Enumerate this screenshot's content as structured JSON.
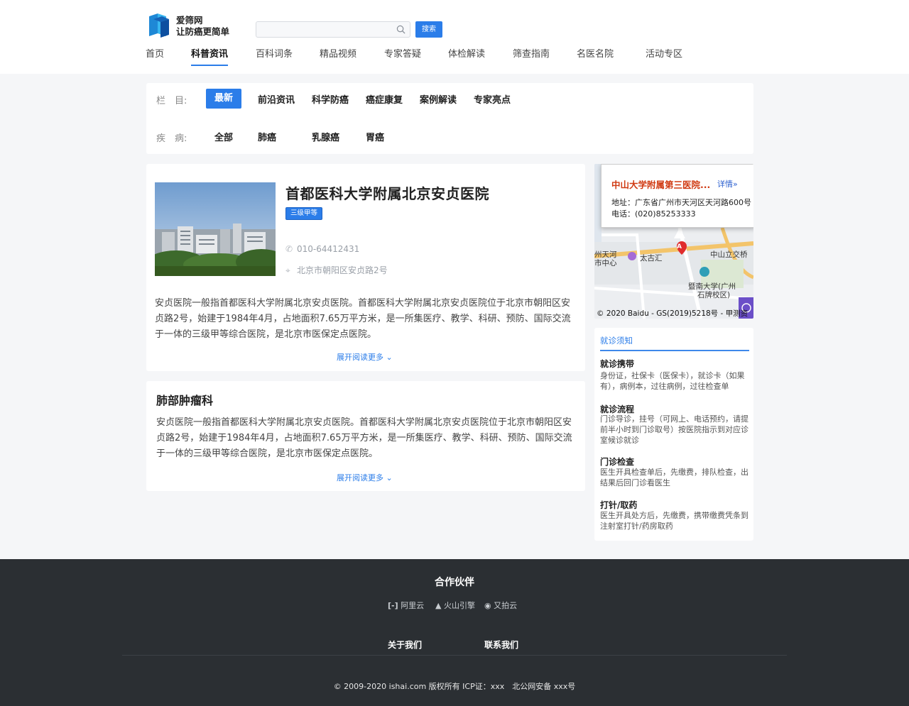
{
  "brand": {
    "name": "爱筛网",
    "slogan": "让防癌更简单"
  },
  "search": {
    "placeholder": "",
    "button": "搜索"
  },
  "nav": [
    "首页",
    "科普资讯",
    "百科词条",
    "精品视频",
    "专家答疑",
    "体检解读",
    "筛查指南",
    "名医名院",
    "活动专区"
  ],
  "nav_active": "科普资讯",
  "filters": {
    "column_label": "栏　目:",
    "columns": [
      "最新",
      "前沿资讯",
      "科学防癌",
      "癌症康复",
      "案例解读",
      "专家亮点"
    ],
    "column_active": "最新",
    "disease_label": "疾　病:",
    "diseases": [
      "全部",
      "肺癌",
      "乳腺癌",
      "胃癌"
    ]
  },
  "hospital": {
    "name": "首都医科大学附属北京安贞医院",
    "level": "三级甲等",
    "phone": "010-64412431",
    "address": "北京市朝阳区安贞路2号",
    "description": "安贞医院一般指首都医科大学附属北京安贞医院。首都医科大学附属北京安贞医院位于北京市朝阳区安贞路2号，始建于1984年4月，占地面积7.65万平方米，是一所集医疗、教学、科研、预防、国际交流于一体的三级甲等综合医院，是北京市医保定点医院。",
    "more": "展开阅读更多"
  },
  "department": {
    "title": "肺部肿瘤科",
    "description": "安贞医院一般指首都医科大学附属北京安贞医院。首都医科大学附属北京安贞医院位于北京市朝阳区安贞路2号，始建于1984年4月，占地面积7.65万平方米，是一所集医疗、教学、科研、预防、国际交流于一体的三级甲等综合医院，是北京市医保定点医院。",
    "more": "展开阅读更多"
  },
  "map": {
    "popup_title": "中山大学附属第三医院...",
    "popup_detail": "详情»",
    "address_line": "地址：广东省广州市天河区天河路600号",
    "phone_line": "电话：(020)85253333",
    "labels": {
      "tianhe": "州天河",
      "center": "市中心",
      "taiguhui": "太古汇",
      "zhongshan": "中山立交桥",
      "jinan1": "暨南大学(广州",
      "jinan2": "石牌校区)",
      "marker": "A"
    },
    "copyright": "© 2020 Baidu - GS(2019)5218号 - 甲测资"
  },
  "notice": {
    "tab": "就诊须知",
    "sections": [
      {
        "title": "就诊携带",
        "text": "身份证，社保卡（医保卡），就诊卡（如果有），病例本，过往病例，过往检查单"
      },
      {
        "title": "就诊流程",
        "text": "门诊导诊，挂号（可网上、电话预约，请提前半小时到门诊取号）按医院指示到对应诊室候诊就诊"
      },
      {
        "title": "门诊检查",
        "text": "医生开具检查单后，先缴费，排队检查，出结果后回门诊看医生"
      },
      {
        "title": "打针/取药",
        "text": "医生开具处方后，先缴费，携带缴费凭条到注射室打针/药房取药"
      }
    ]
  },
  "footer": {
    "partners_title": "合作伙伴",
    "partners": [
      "阿里云",
      "火山引擎",
      "又拍云"
    ],
    "links": [
      "关于我们",
      "联系我们"
    ],
    "copyright": "© 2009-2020 ishai.com 版权所有 ICP证：xxx　北公网安备 xxx号"
  },
  "colors": {
    "accent": "#2b7de9",
    "footer_bg": "#2b2f33",
    "popup_title": "#d03a12"
  }
}
